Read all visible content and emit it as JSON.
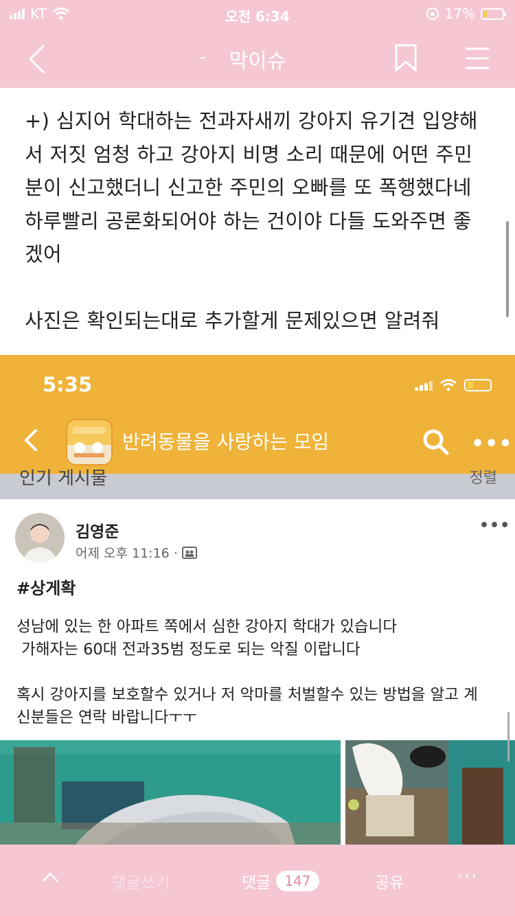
{
  "status_bar": {
    "carrier": "KT",
    "time": "오전 6:34",
    "battery": "17%"
  },
  "nav": {
    "dash": "-",
    "title": "막이슈"
  },
  "article": {
    "lines": [
      "+) 심지어 학대하는 전과자새끼 강아지 유기견 입양해",
      "서 저짓 엄청 하고 강아지 비명 소리 때문에 어떤 주민",
      "분이 신고했더니 신고한 주민의 오빠를 또 폭행했다네",
      "하루빨리 공론화되어야 하는 건이야 다들 도와주면 좋",
      "겠어",
      "",
      "사진은 확인되는대로 추가할게 문제있으면 알려줘"
    ]
  },
  "screenshot": {
    "time": "5:35",
    "group_name": "반려동물을 사랑하는 모임",
    "band_text": "인기 게시물",
    "band_right": "정렬",
    "post": {
      "author": "김영준",
      "meta": "어제 오후 11:16 ·",
      "hashtag": "#상게확",
      "body": [
        "성남에 있는 한 아파트 쪽에서 심한 강아지 학대가 있습니다",
        " 가해자는 60대 전과35범 정도로 되는 악질 이랍니다",
        "",
        "혹시 강아지를 보호할수 있거나 저 악마를 처벌할수 있는 방법을 알고 계",
        "신분들은 연락 바랍니다ㅜㅜ"
      ]
    }
  },
  "bottom_bar": {
    "write_label": "댓글쓰기",
    "comment_label": "댓글",
    "comment_count": "147",
    "share_label": "공유",
    "more_label": "···"
  },
  "colors": {
    "pink": "#f5c7d3",
    "orange": "#efb33a",
    "badge_text": "#e58aa3"
  }
}
